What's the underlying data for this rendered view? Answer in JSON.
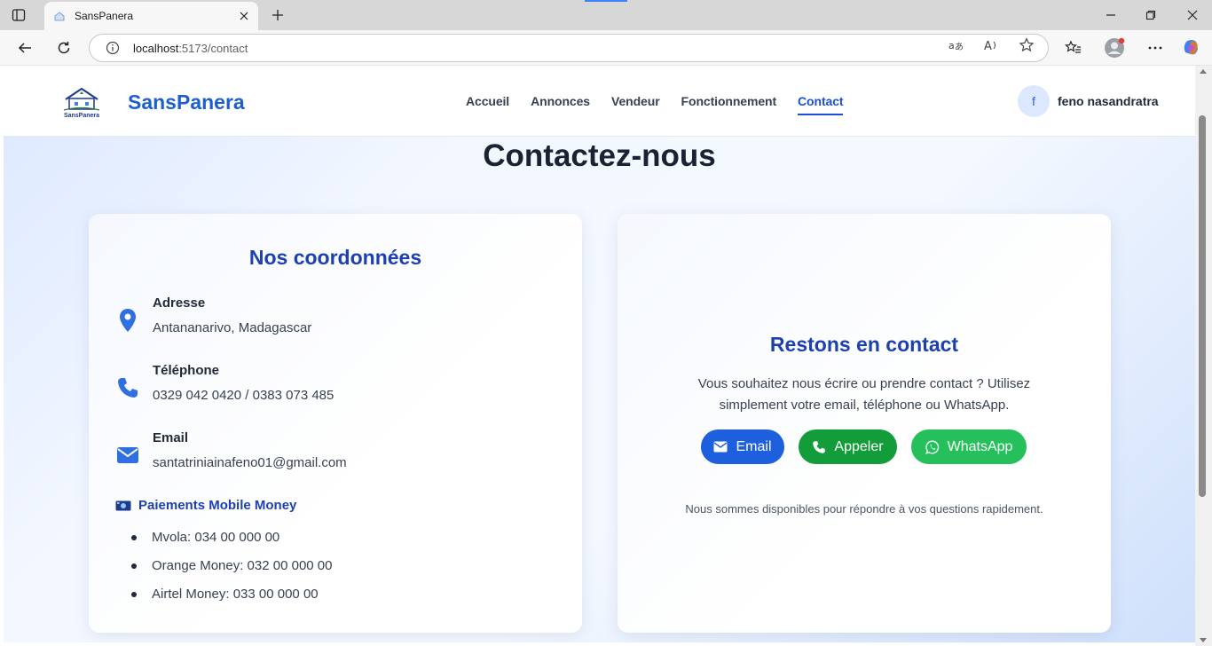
{
  "browser": {
    "tab_title": "SansPanera",
    "url_host": "localhost",
    "url_path": ":5173/contact",
    "accent": "#3b82f6"
  },
  "site": {
    "logo_text": "SansPanera",
    "brand": "SansPanera",
    "nav": [
      {
        "label": "Accueil",
        "active": false
      },
      {
        "label": "Annonces",
        "active": false
      },
      {
        "label": "Vendeur",
        "active": false
      },
      {
        "label": "Fonctionnement",
        "active": false
      },
      {
        "label": "Contact",
        "active": true
      }
    ],
    "user": {
      "initial": "f",
      "name": "feno nasandratra"
    }
  },
  "page": {
    "title": "Contactez-nous",
    "coords": {
      "title": "Nos coordonnées",
      "address": {
        "label": "Adresse",
        "value": "Antananarivo, Madagascar",
        "icon": "location-pin-icon"
      },
      "phone": {
        "label": "Téléphone",
        "value": "0329 042 0420 / 0383 073 485",
        "icon": "phone-icon"
      },
      "email": {
        "label": "Email",
        "value": "santatriniainafeno01@gmail.com",
        "icon": "envelope-icon"
      },
      "mobile_money": {
        "title": "Paiements Mobile Money",
        "items": [
          "Mvola: 034 00 000 00",
          "Orange Money: 032 00 000 00",
          "Airtel Money: 033 00 000 00"
        ]
      }
    },
    "contact": {
      "title": "Restons en contact",
      "description": "Vous souhaitez nous écrire ou prendre contact ? Utilisez simplement votre email, téléphone ou WhatsApp.",
      "buttons": {
        "email": "Email",
        "call": "Appeler",
        "whatsapp": "WhatsApp"
      },
      "availability": "Nous sommes disponibles pour répondre à vos questions rapidement."
    }
  },
  "colors": {
    "primary": "#1d4ed8",
    "email_button": "#1d5fdd",
    "call_button": "#129c3a",
    "whatsapp_button": "#25c05b"
  }
}
